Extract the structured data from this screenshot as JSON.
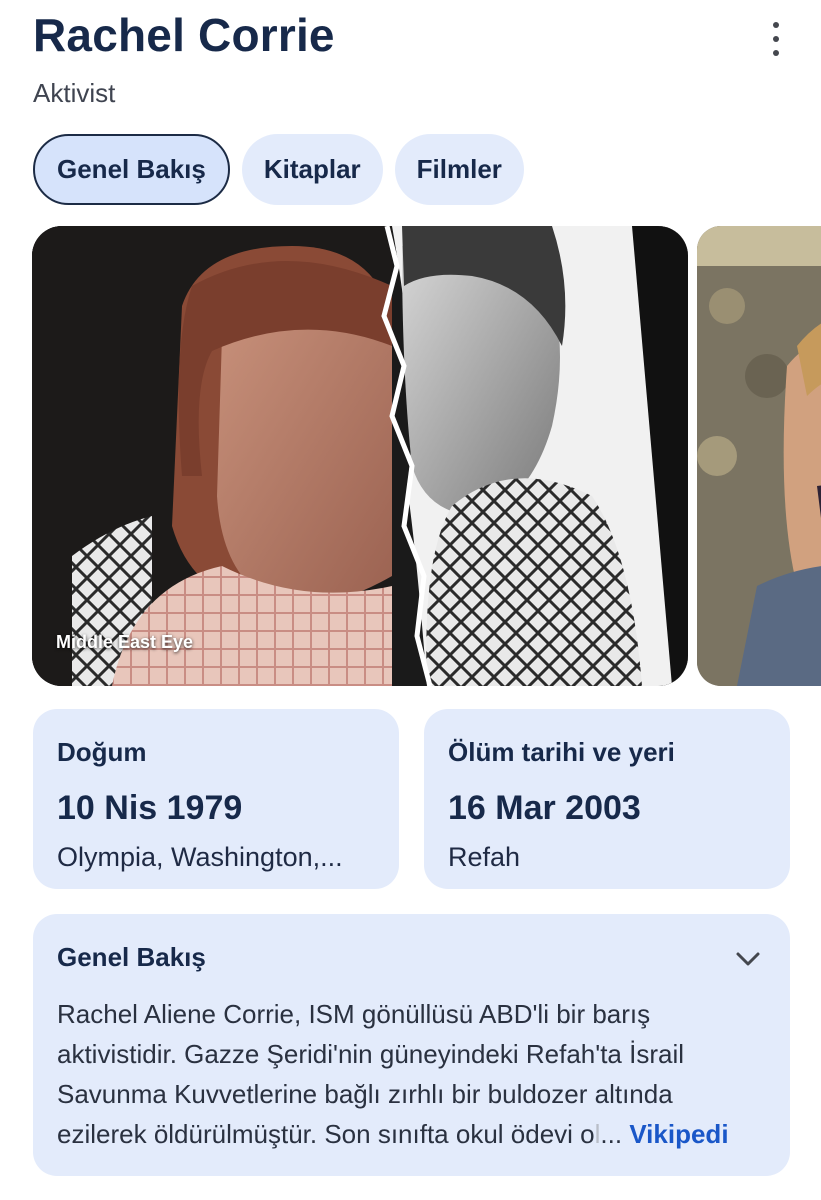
{
  "header": {
    "title": "Rachel Corrie",
    "subtitle": "Aktivist",
    "more_icon": "more-vert-icon"
  },
  "tabs": [
    {
      "label": "Genel Bakış",
      "active": true
    },
    {
      "label": "Kitaplar",
      "active": false
    },
    {
      "label": "Filmler",
      "active": false
    }
  ],
  "gallery": {
    "images": [
      {
        "caption": "Middle East Eye"
      },
      {
        "caption": ""
      }
    ]
  },
  "facts": {
    "birth": {
      "label": "Doğum",
      "date": "10 Nis 1979",
      "place": "Olympia, Washington,..."
    },
    "death": {
      "label": "Ölüm tarihi ve yeri",
      "date": "16 Mar 2003",
      "place": "Refah"
    }
  },
  "overview": {
    "label": "Genel Bakış",
    "expand_icon": "chevron-down-icon",
    "lines": [
      "Rachel Aliene Corrie, ISM gönüllüsü ABD'li bir barış",
      "aktivistidir. Gazze Şeridi'nin güneyindeki Refah'ta İsrail",
      "Savunma Kuvvetlerine bağlı zırhlı bir buldozer altında"
    ],
    "last_line": "ezilerek öldürülmüştür. Son sınıfta okul ödevi o",
    "last_line_fade": "l",
    "ellipsis": "...",
    "source_link": "Vikipedi"
  },
  "colors": {
    "accent": "#1a57c8",
    "card_bg": "#e3ebfb",
    "title": "#17294a"
  }
}
